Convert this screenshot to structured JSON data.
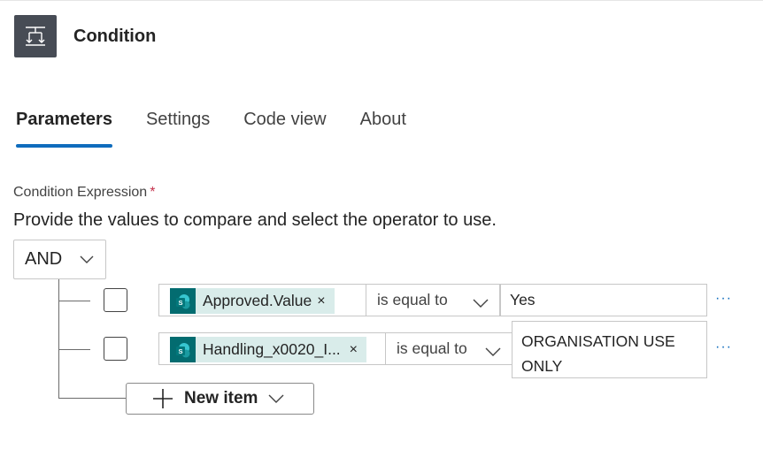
{
  "header": {
    "title": "Condition",
    "icon": "condition-icon",
    "icon_bg": "#474c55"
  },
  "tabs": [
    {
      "label": "Parameters",
      "active": true
    },
    {
      "label": "Settings",
      "active": false
    },
    {
      "label": "Code view",
      "active": false
    },
    {
      "label": "About",
      "active": false
    }
  ],
  "condition": {
    "label": "Condition Expression",
    "required_mark": "*",
    "description": "Provide the values to compare and select the operator to use.",
    "group_operator": "AND",
    "rows": [
      {
        "token_label": "Approved.Value",
        "token_icon": "sharepoint-icon",
        "remove_symbol": "×",
        "operator": "is equal to",
        "value": "Yes",
        "more": "···"
      },
      {
        "token_label": "Handling_x0020_I...",
        "token_icon": "sharepoint-icon",
        "remove_symbol": "×",
        "operator": "is equal to",
        "value_line1": "ORGANISATION USE",
        "value_line2": "ONLY",
        "more": "···"
      }
    ],
    "new_item_label": "New item"
  },
  "colors": {
    "accent": "#0f6cbd",
    "token_bg": "#d9ecea",
    "sharepoint": "#036c70",
    "required": "#c4314b"
  }
}
